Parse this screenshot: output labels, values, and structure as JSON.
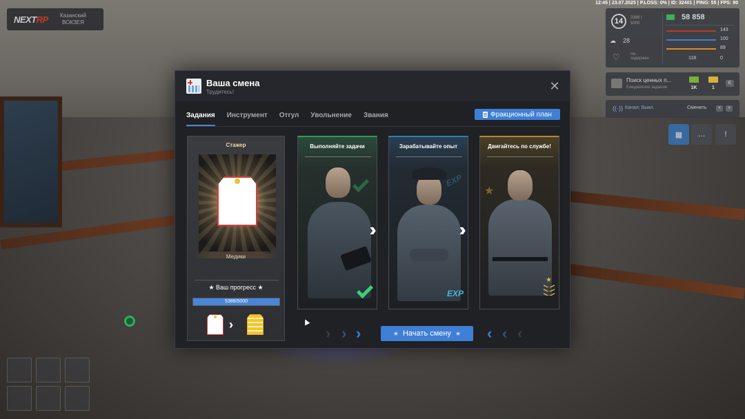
{
  "logo": {
    "brand_prefix": "NEXT",
    "brand_suffix": "RP",
    "city": "Казанский",
    "region": "ВОКЗЕЯ"
  },
  "status_bar": "12:45 | 23.07.2025 | P.LOSS: 0% | ID: 32401 | PING: 55 | FPS: 90",
  "hud": {
    "level": "14",
    "exp_line1": "3388 /",
    "exp_line2": "5000",
    "money": "58 858",
    "wanted": "28",
    "health_value": "143",
    "armor_value": "100",
    "hunger_value": "89",
    "ammo_value": "118",
    "shield_value": "0",
    "status_label": "Не",
    "status_label2": "задержан",
    "health_color": "#c0392b",
    "armor_color": "#3f7fd6",
    "hunger_color": "#e08a2f",
    "ammo_color": "#9aa0a6"
  },
  "quest": {
    "title": "Поиск ценных п...",
    "subtitle": "Ежедневное задание",
    "reward1": "1K",
    "reward2": "1",
    "key": "E"
  },
  "radio": {
    "channel": "Канал: Выкл.",
    "change_label": "Сменить",
    "prev_key": "<",
    "next_key": ">"
  },
  "quick_buttons": {
    "calendar": "▦",
    "chat": "…",
    "alerts": "!"
  },
  "modal": {
    "title": "Ваша смена",
    "subtitle": "Трудитесь!",
    "tabs": [
      {
        "label": "Задания"
      },
      {
        "label": "Инструмент"
      },
      {
        "label": "Отгул"
      },
      {
        "label": "Увольнение"
      },
      {
        "label": "Звания"
      }
    ],
    "faction_button": "Фракционный план",
    "rank_card": {
      "title": "Стажер",
      "rank_name": "Медики",
      "progress_title": "★ Ваш прогресс ★",
      "progress_text": "5388/5000",
      "progress_fraction": 1.0
    },
    "steps": [
      {
        "title": "Выполняйте задачи"
      },
      {
        "title": "Зарабатывайте опыт",
        "badge": "EXP"
      },
      {
        "title": "Двигайтесь по службе!"
      }
    ],
    "start_button": "Начать смену",
    "start_star": "★"
  }
}
